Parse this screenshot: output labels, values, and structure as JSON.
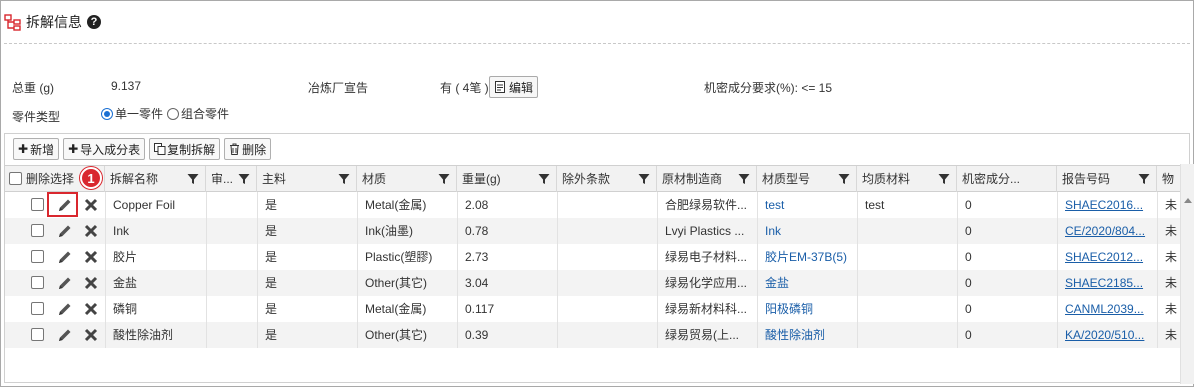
{
  "header": {
    "title": "拆解信息",
    "help_glyph": "?"
  },
  "info": {
    "total_weight_label": "总重 (g)",
    "total_weight_value": "9.137",
    "smelter_label": "冶炼厂宣告",
    "smelter_value": "有 ( 4笔 )",
    "edit_label": "编辑",
    "confidential_label": "机密成分要求(%): <= 15",
    "part_type_label": "零件类型",
    "part_type_options": [
      "单一零件",
      "组合零件"
    ],
    "part_type_selected": "单一零件"
  },
  "toolbar": {
    "add_label": "新增",
    "import_label": "导入成分表",
    "copy_label": "复制拆解",
    "delete_label": "删除"
  },
  "table": {
    "columns": {
      "delete_select": "删除选择",
      "name": "拆解名称",
      "review": "审...",
      "main_material": "主料",
      "material": "材质",
      "weight": "重量(g)",
      "exemption": "除外条款",
      "manufacturer": "原材制造商",
      "material_model": "材质型号",
      "homogeneous": "均质材料",
      "confidential": "机密成分...",
      "report_no": "报告号码",
      "extra": "物"
    },
    "rows": [
      {
        "name": "Copper Foil",
        "main": "是",
        "material": "Metal(金属)",
        "weight": "2.08",
        "manufacturer": "合肥绿易软件...",
        "model": "test",
        "homogeneous": "test",
        "confidential": "0",
        "report": "SHAEC2016...",
        "extra": "未"
      },
      {
        "name": "Ink",
        "main": "是",
        "material": "Ink(油墨)",
        "weight": "0.78",
        "manufacturer": "Lvyi Plastics ...",
        "model": "Ink",
        "homogeneous": "",
        "confidential": "0",
        "report": "CE/2020/804...",
        "extra": "未"
      },
      {
        "name": "胶片",
        "main": "是",
        "material": "Plastic(塑膠)",
        "weight": "2.73",
        "manufacturer": "绿易电子材料...",
        "model": "胶片EM-37B(5)",
        "homogeneous": "",
        "confidential": "0",
        "report": "SHAEC2012...",
        "extra": "未"
      },
      {
        "name": "金盐",
        "main": "是",
        "material": "Other(其它)",
        "weight": "3.04",
        "manufacturer": "绿易化学应用...",
        "model": "金盐",
        "homogeneous": "",
        "confidential": "0",
        "report": "SHAEC2185...",
        "extra": "未"
      },
      {
        "name": "磷铜",
        "main": "是",
        "material": "Metal(金属)",
        "weight": "0.117",
        "manufacturer": "绿易新材料科...",
        "model": "阳极磷铜",
        "homogeneous": "",
        "confidential": "0",
        "report": "CANML2039...",
        "extra": "未"
      },
      {
        "name": "酸性除油剂",
        "main": "是",
        "material": "Other(其它)",
        "weight": "0.39",
        "manufacturer": "绿易贸易(上...",
        "model": "酸性除油剂",
        "homogeneous": "",
        "confidential": "0",
        "report": "KA/2020/510...",
        "extra": "未"
      }
    ]
  },
  "callout": {
    "step": "1"
  },
  "colors": {
    "accent": "#1a6fd3",
    "link": "#1a5ea8",
    "callout": "#d9272e"
  }
}
